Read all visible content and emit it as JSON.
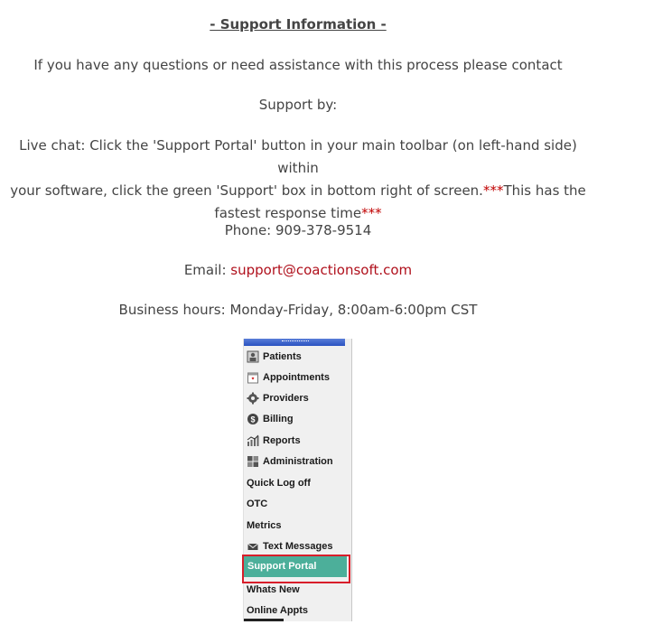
{
  "support": {
    "title": "- Support Information -",
    "intro": "If you have any questions or need assistance with this process please contact",
    "support_by": "Support by:",
    "live_chat_line1": "Live chat: Click the 'Support Portal' button in your main toolbar (on left-hand side) within",
    "live_chat_line2_a": "your software, click the green 'Support' box in bottom right of screen.",
    "live_chat_line2_b": "***",
    "live_chat_line2_c": "This has the",
    "live_chat_line3_a": "fastest response time",
    "live_chat_line3_b": "***",
    "phone": "Phone: 909-378-9514",
    "email_label": "Email: ",
    "email": "support@coactionsoft.com",
    "hours": "Business hours: Monday-Friday, 8:00am-6:00pm CST"
  },
  "menu": {
    "items": [
      {
        "label": "Patients",
        "icon": "patients-icon"
      },
      {
        "label": "Appointments",
        "icon": "appointments-icon"
      },
      {
        "label": "Providers",
        "icon": "gear-icon"
      },
      {
        "label": "Billing",
        "icon": "billing-icon"
      },
      {
        "label": "Reports",
        "icon": "chart-icon"
      },
      {
        "label": "Administration",
        "icon": "admin-icon"
      },
      {
        "label": "Quick Log off",
        "icon": ""
      },
      {
        "label": "OTC",
        "icon": ""
      },
      {
        "label": "Metrics",
        "icon": ""
      },
      {
        "label": "Text Messages",
        "icon": "envelope-icon"
      },
      {
        "label": "Support Portal",
        "icon": ""
      },
      {
        "label": "Whats New",
        "icon": ""
      },
      {
        "label": "Online Appts",
        "icon": ""
      }
    ],
    "selected_color": "#4caf9a",
    "highlight_color": "#d81e2a"
  }
}
